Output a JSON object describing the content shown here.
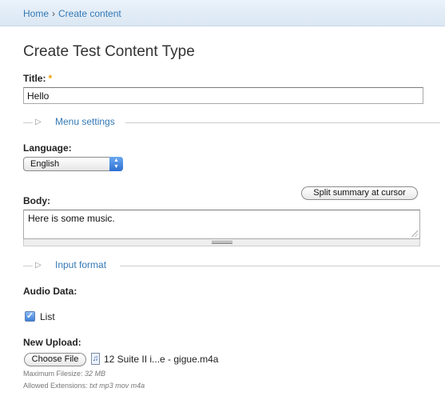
{
  "breadcrumb": {
    "home": "Home",
    "separator": "›",
    "current": "Create content"
  },
  "page_title": "Create Test Content Type",
  "title_field": {
    "label": "Title:",
    "required_mark": "*",
    "value": "Hello"
  },
  "menu_settings": {
    "legend": "Menu settings",
    "icon": "triangle-right-icon"
  },
  "language": {
    "label": "Language:",
    "selected": "English"
  },
  "body": {
    "label": "Body:",
    "split_button": "Split summary at cursor",
    "value": "Here is some music."
  },
  "input_format": {
    "legend": "Input format",
    "icon": "triangle-right-icon"
  },
  "audio_data": {
    "label": "Audio Data:",
    "list_label": "List",
    "list_checked": true
  },
  "new_upload": {
    "label": "New Upload:",
    "choose_button": "Choose File",
    "file_name": "12 Suite II i...e - gigue.m4a",
    "max_filesize_label": "Maximum Filesize:",
    "max_filesize_value": "32 MB",
    "allowed_ext_label": "Allowed Extensions:",
    "allowed_ext_value": "txt mp3 mov m4a"
  },
  "colors": {
    "link": "#3479b5",
    "required": "#f0a000",
    "select_accent": "#2d6fd1"
  }
}
